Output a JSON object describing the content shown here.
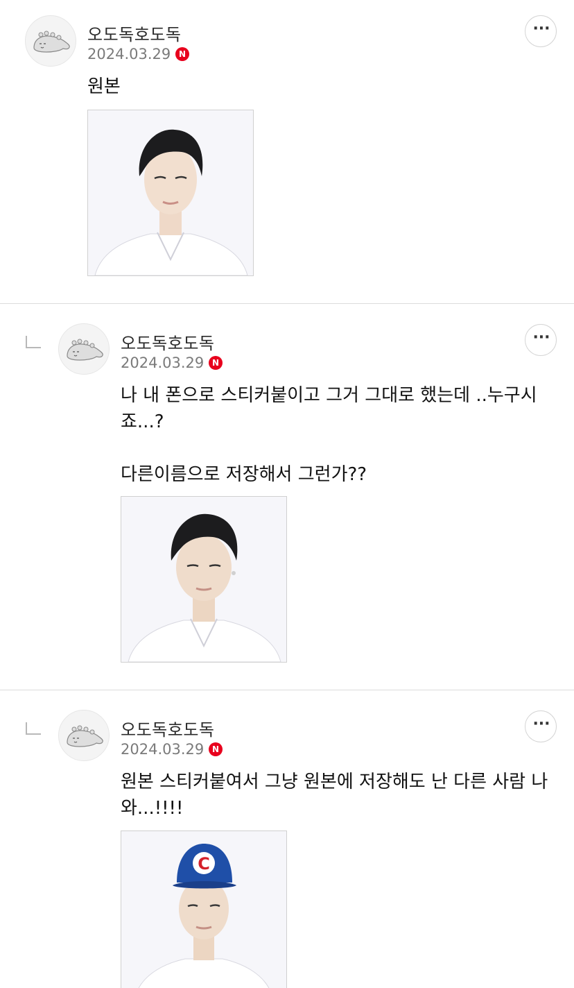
{
  "comments": [
    {
      "author": "오도독호도독",
      "date": "2024.03.29",
      "badge": "N",
      "text_lines": [
        "원본"
      ],
      "photo": "man-black-hair-white-shirt-portrait"
    },
    {
      "author": "오도독호도독",
      "date": "2024.03.29",
      "badge": "N",
      "text_lines": [
        "나 내 폰으로 스티커붙이고 그거 그대로 했는데 ..누구시",
        "죠...?",
        "",
        "다른이름으로 저장해서 그런가??"
      ],
      "photo": "man-black-hair-earring-portrait"
    },
    {
      "author": "오도독호도독",
      "date": "2024.03.29",
      "badge": "N",
      "text_lines": [
        "원본 스티커붙여서 그냥 원본에 저장해도 난 다른 사람 나",
        "와...!!!!"
      ],
      "photo": "man-blue-cap-portrait"
    }
  ],
  "icons": {
    "avatar": "dinosaur-avatar-icon",
    "more": "more-options-icon",
    "reply": "reply-indicator-icon",
    "badge": "naver-n-badge-icon"
  },
  "colors": {
    "badge": "#e8001d",
    "divider": "#dcdcdc",
    "cap": "#1f4fa8"
  }
}
